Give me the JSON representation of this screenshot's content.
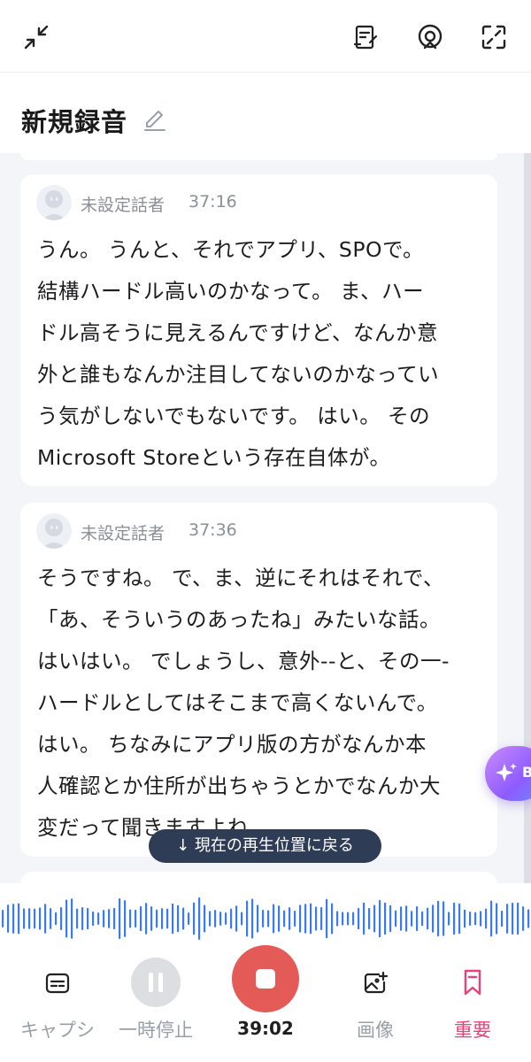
{
  "header": {
    "icons": [
      "minimize-icon",
      "notes-icon",
      "live-icon",
      "fullscreen-icon"
    ]
  },
  "title": "新規録音",
  "transcript": [
    {
      "speaker": "未設定話者",
      "time": "37:16",
      "lines": [
        "うん。 うんと、それでアプリ、SPOで。",
        "結構ハードル高いのかなって。 ま、ハー",
        "ドル高そうに見えるんですけど、なんか意",
        "外と誰もなんか注目してないのかなってい",
        "う気がしないでもないです。 はい。 その",
        "Microsoft Storeという存在自体が。"
      ]
    },
    {
      "speaker": "未設定話者",
      "time": "37:36",
      "lines": [
        "そうですね。 で、ま、逆にそれはそれで、",
        "「あ、そういうのあったね」みたいな話。",
        "はいはい。 でしょうし、意外--と、その一-",
        "ハードルとしてはそこまで高くないんで。",
        "はい。 ちなみにアプリ版の方がなんか本",
        "人確認とか住所が出ちゃうとかでなんか大",
        "変だって聞きますよね。"
      ]
    }
  ],
  "floating_button": {
    "label": "B"
  },
  "return_pill": "↓ 現在の再生位置に戻る",
  "controls": {
    "caption": "キャプシ",
    "pause": "一時停止",
    "elapsed": "39:02",
    "image": "画像",
    "important": "重要"
  },
  "colors": {
    "accent_record": "#e35a56",
    "important": "#e8417c",
    "waveform": "#3a7cf0",
    "pill": "#2f3c55"
  }
}
